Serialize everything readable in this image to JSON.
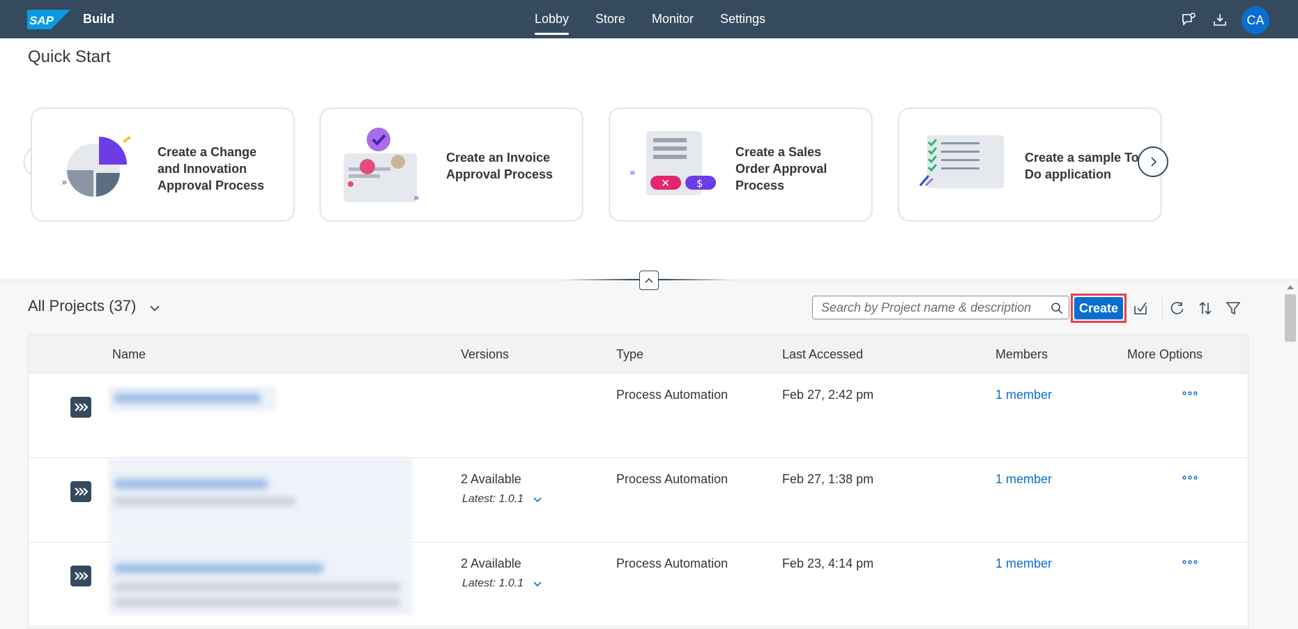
{
  "shell": {
    "logo": "SAP",
    "title": "Build",
    "nav": [
      "Lobby",
      "Store",
      "Monitor",
      "Settings"
    ],
    "active_nav": "Lobby",
    "icons": [
      "feedback-icon",
      "download-icon"
    ],
    "avatar_initials": "CA"
  },
  "quick_start": {
    "title": "Quick Start",
    "cards": [
      {
        "title": "Create a Change and Innovation Approval Process"
      },
      {
        "title": "Create an Invoice Approval Process"
      },
      {
        "title": "Create a Sales Order Approval Process"
      },
      {
        "title": "Create a sample To-Do application"
      }
    ]
  },
  "projects": {
    "title": "All Projects (37)",
    "search_placeholder": "Search by Project name & description",
    "create_label": "Create",
    "columns": [
      "Name",
      "Versions",
      "Type",
      "Last Accessed",
      "Members",
      "More Options"
    ],
    "rows": [
      {
        "versions": "",
        "latest": "",
        "type": "Process Automation",
        "last_accessed": "Feb 27, 2:42 pm",
        "members": "1 member"
      },
      {
        "versions": "2 Available",
        "latest": "Latest: 1.0.1",
        "type": "Process Automation",
        "last_accessed": "Feb 27, 1:38 pm",
        "members": "1 member"
      },
      {
        "versions": "2 Available",
        "latest": "Latest: 1.0.1",
        "type": "Process Automation",
        "last_accessed": "Feb 23, 4:14 pm",
        "members": "1 member"
      }
    ]
  },
  "colors": {
    "shell_bg": "#354a5f",
    "accent": "#0a6ed1",
    "highlight": "#e3444a"
  }
}
